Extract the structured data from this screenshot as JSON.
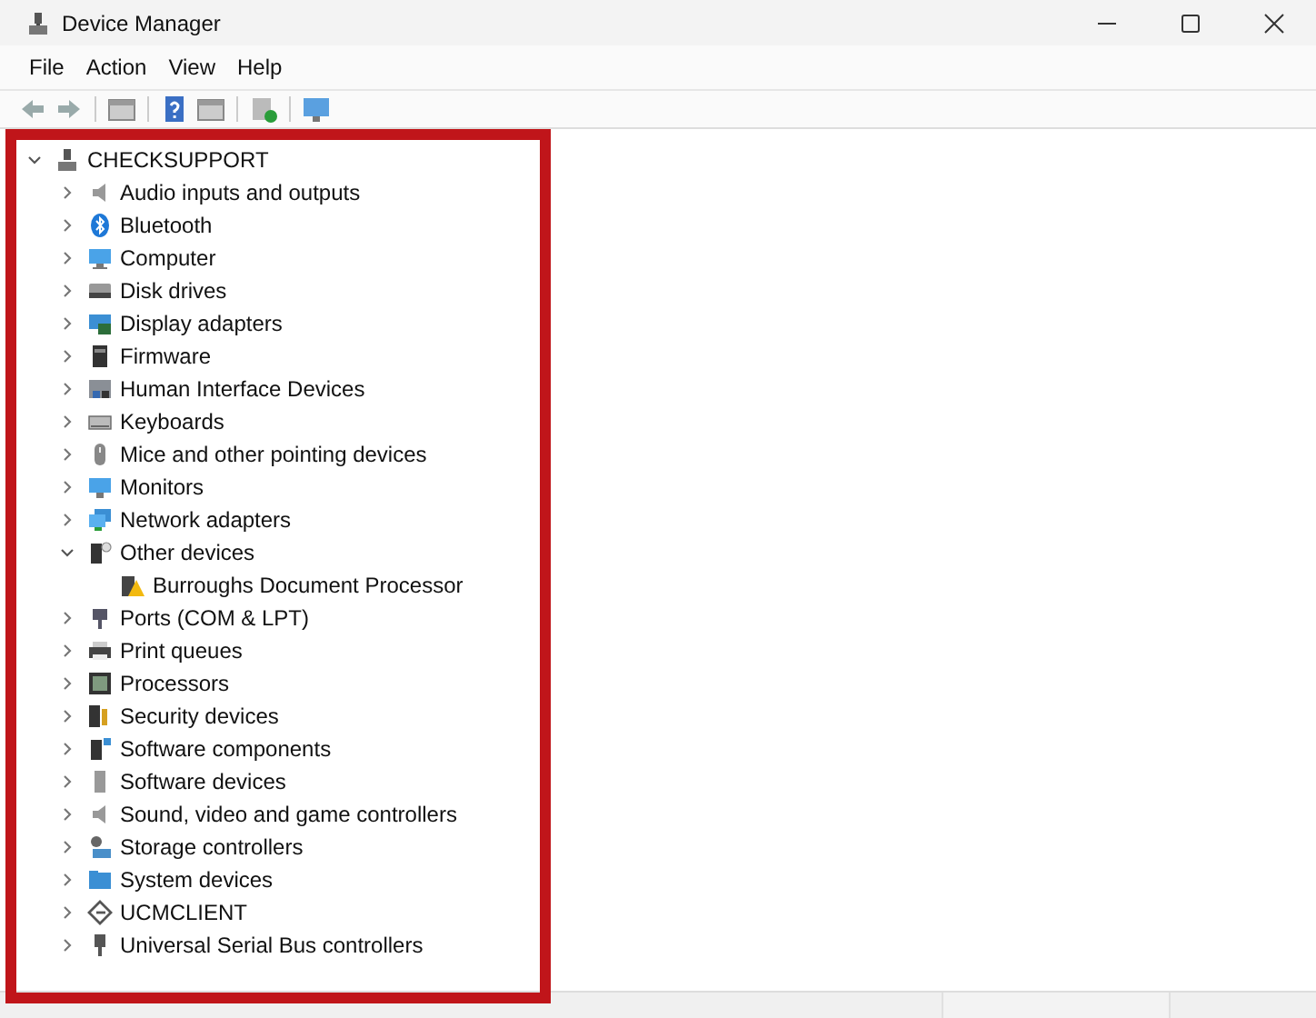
{
  "window": {
    "title": "Device Manager"
  },
  "menu": [
    "File",
    "Action",
    "View",
    "Help"
  ],
  "tree": [
    {
      "label": "CHECKSUPPORT",
      "expanded": true,
      "children": [
        {
          "label": "Audio inputs and outputs",
          "expanded": false
        },
        {
          "label": "Bluetooth",
          "expanded": false
        },
        {
          "label": "Computer",
          "expanded": false
        },
        {
          "label": "Disk drives",
          "expanded": false
        },
        {
          "label": "Display adapters",
          "expanded": false
        },
        {
          "label": "Firmware",
          "expanded": false
        },
        {
          "label": "Human Interface Devices",
          "expanded": false
        },
        {
          "label": "Keyboards",
          "expanded": false
        },
        {
          "label": "Mice and other pointing devices",
          "expanded": false
        },
        {
          "label": "Monitors",
          "expanded": false
        },
        {
          "label": "Network adapters",
          "expanded": false
        },
        {
          "label": "Other devices",
          "expanded": true,
          "children": [
            {
              "label": "Burroughs Document Processor"
            }
          ]
        },
        {
          "label": "Ports (COM & LPT)",
          "expanded": false
        },
        {
          "label": "Print queues",
          "expanded": false
        },
        {
          "label": "Processors",
          "expanded": false
        },
        {
          "label": "Security devices",
          "expanded": false
        },
        {
          "label": "Software components",
          "expanded": false
        },
        {
          "label": "Software devices",
          "expanded": false
        },
        {
          "label": "Sound, video and game controllers",
          "expanded": false
        },
        {
          "label": "Storage controllers",
          "expanded": false
        },
        {
          "label": "System devices",
          "expanded": false
        },
        {
          "label": "UCMCLIENT",
          "expanded": false
        },
        {
          "label": "Universal Serial Bus controllers",
          "expanded": false
        }
      ]
    }
  ],
  "highlight": {
    "kind": "frame"
  }
}
